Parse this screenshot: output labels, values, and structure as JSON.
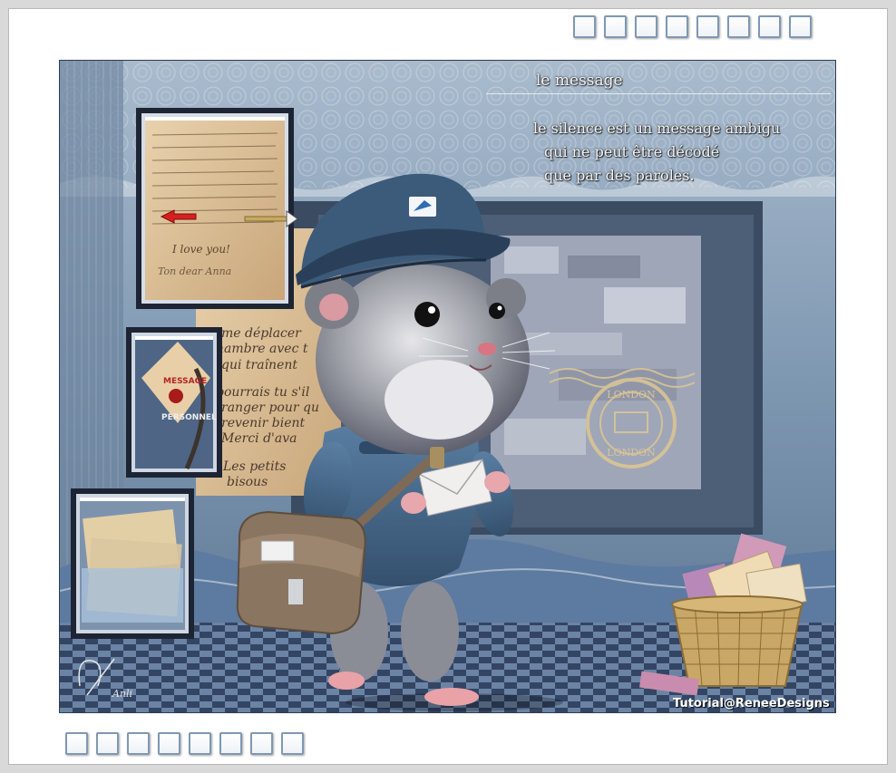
{
  "poem": {
    "title": "le message",
    "lines": [
      "le silence est un message ambigu",
      "qui ne peut être décodé",
      "que par des paroles."
    ]
  },
  "letter_text": {
    "love": "I love you!",
    "sign": "Ton dear Anna",
    "envelope_line1": "MESSAGE",
    "envelope_line2": "PERSONNEL"
  },
  "back_letter_lines": [
    "me déplacer",
    "hambre avec t",
    "qui traînent",
    "pourrais tu s'il",
    "ranger pour qu",
    "revenir bient",
    "Merci d'ava",
    "Les petits",
    "bisous"
  ],
  "stamp": {
    "text_top": "LONDON",
    "text_bottom": "LONDON"
  },
  "watermark": "Tutorial@ReneeDesigns",
  "signature": "Anli",
  "frame": {
    "square_count_top": 8,
    "square_count_bottom": 8
  },
  "colors": {
    "frame_border": "#d9d9d9",
    "square_border": "#7f98b4",
    "sky": "#8fa7c0",
    "cap_blue": "#3c5a7a",
    "bag_brown": "#8a7560",
    "basket": "#c9a766"
  }
}
